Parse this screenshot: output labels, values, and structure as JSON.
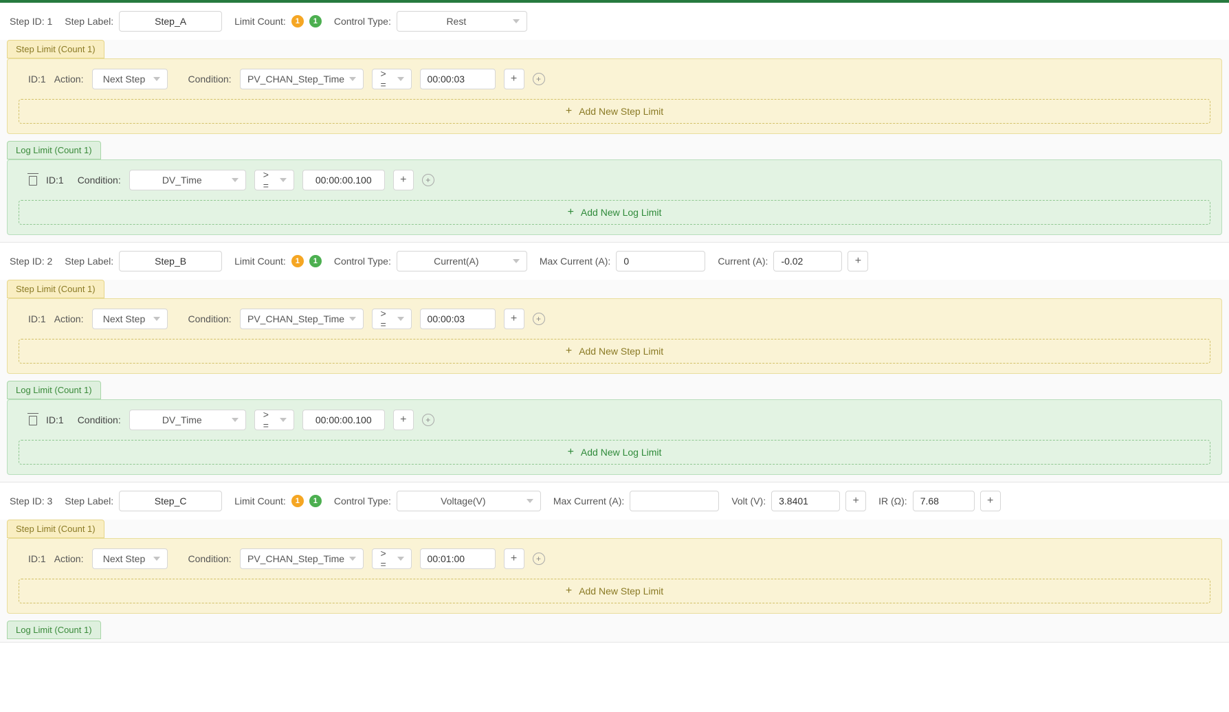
{
  "labels": {
    "step_id": "Step ID:",
    "step_label": "Step Label:",
    "limit_count": "Limit Count:",
    "control_type": "Control Type:",
    "max_current": "Max Current (A):",
    "current": "Current (A):",
    "volt": "Volt (V):",
    "ir": "IR (Ω):",
    "id": "ID:",
    "action": "Action:",
    "condition": "Condition:",
    "add_step_limit": "Add New Step Limit",
    "add_log_limit": "Add New Log Limit"
  },
  "steps": [
    {
      "step_id": "1",
      "step_label": "Step_A",
      "limit_orange": "1",
      "limit_green": "1",
      "control_type": "Rest",
      "step_limit_tab": "Step Limit (Count 1)",
      "log_limit_tab": "Log Limit (Count 1)",
      "step_limit": {
        "id": "1",
        "action": "Next Step",
        "cond_var": "PV_CHAN_Step_Time",
        "op": "> =",
        "value": "00:00:03"
      },
      "log_limit": {
        "id": "1",
        "cond_var": "DV_Time",
        "op": "> =",
        "value": "00:00:00.100"
      }
    },
    {
      "step_id": "2",
      "step_label": "Step_B",
      "limit_orange": "1",
      "limit_green": "1",
      "control_type": "Current(A)",
      "max_current": "0",
      "current": "-0.02",
      "step_limit_tab": "Step Limit (Count 1)",
      "log_limit_tab": "Log Limit (Count 1)",
      "step_limit": {
        "id": "1",
        "action": "Next Step",
        "cond_var": "PV_CHAN_Step_Time",
        "op": "> =",
        "value": "00:00:03"
      },
      "log_limit": {
        "id": "1",
        "cond_var": "DV_Time",
        "op": "> =",
        "value": "00:00:00.100"
      }
    },
    {
      "step_id": "3",
      "step_label": "Step_C",
      "limit_orange": "1",
      "limit_green": "1",
      "control_type": "Voltage(V)",
      "max_current": "",
      "volt": "3.8401",
      "ir": "7.68",
      "step_limit_tab": "Step Limit (Count 1)",
      "log_limit_tab": "Log Limit (Count 1)",
      "step_limit": {
        "id": "1",
        "action": "Next Step",
        "cond_var": "PV_CHAN_Step_Time",
        "op": "> =",
        "value": "00:01:00"
      }
    }
  ]
}
